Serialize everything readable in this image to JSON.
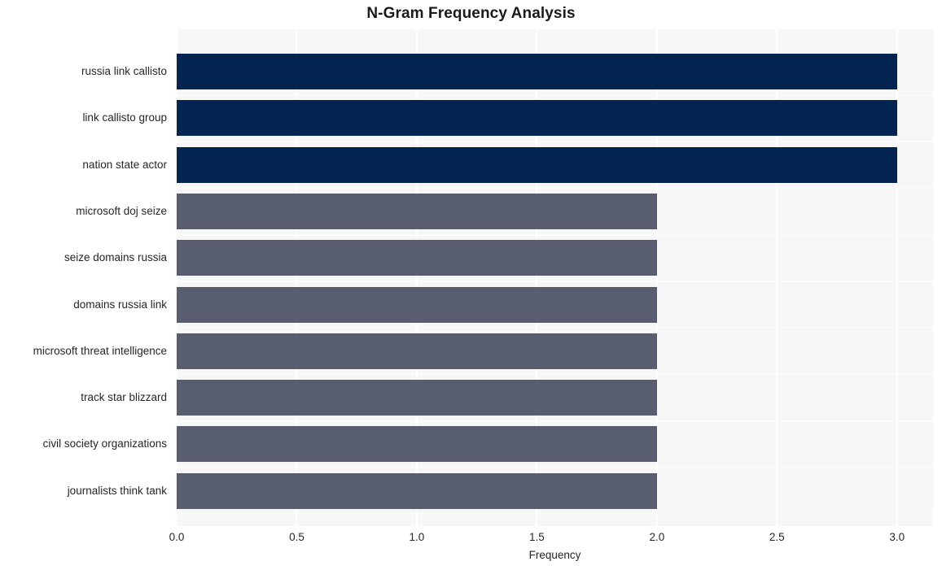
{
  "chart_data": {
    "type": "bar",
    "orientation": "horizontal",
    "title": "N-Gram Frequency Analysis",
    "xlabel": "Frequency",
    "ylabel": "",
    "xlim": [
      0,
      3.15
    ],
    "xticks": [
      "0.0",
      "0.5",
      "1.0",
      "1.5",
      "2.0",
      "2.5",
      "3.0"
    ],
    "xtick_values": [
      0.0,
      0.5,
      1.0,
      1.5,
      2.0,
      2.5,
      3.0
    ],
    "grid": true,
    "legend": "none",
    "categories": [
      "russia link callisto",
      "link callisto group",
      "nation state actor",
      "microsoft doj seize",
      "seize domains russia",
      "domains russia link",
      "microsoft threat intelligence",
      "track star blizzard",
      "civil society organizations",
      "journalists think tank"
    ],
    "values": [
      3,
      3,
      3,
      2,
      2,
      2,
      2,
      2,
      2,
      2
    ],
    "bar_colors": [
      "#042452",
      "#042452",
      "#042452",
      "#585e70",
      "#585e70",
      "#585e70",
      "#585e70",
      "#585e70",
      "#585e70",
      "#585e70"
    ]
  },
  "style": {
    "plot_background": "#f7f7f8",
    "figure_background": "#ffffff",
    "gridline_color": "#ffffff",
    "text_color": "#262626",
    "title_color": "#1a1a1a",
    "accent_high": "#042452",
    "accent_low": "#585e70"
  }
}
